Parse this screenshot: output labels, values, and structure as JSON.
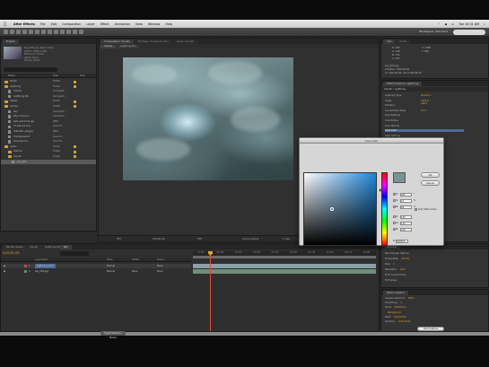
{
  "menubar": {
    "apple": "",
    "app": "After Effects",
    "items": [
      "File",
      "Edit",
      "Composition",
      "Layer",
      "Effect",
      "Animation",
      "View",
      "Window",
      "Help"
    ],
    "clock": "Tue 10:31 AM",
    "right_icons": [
      "wifi-icon",
      "volume-icon",
      "battery-icon"
    ]
  },
  "toolbar": {
    "workspace_label": "Workspace: Standard",
    "search_placeholder": "Search Help"
  },
  "project": {
    "tab": "Project",
    "meta": [
      "sky_001.jpg, used 1 time",
      "1920 x 1080 (1.00)",
      "Millions of Colors",
      "Alpha: None",
      "Frame: Direct"
    ],
    "columns": {
      "name": "Name",
      "type": "Type",
      "size": "Size"
    },
    "items": [
      {
        "name": "Solids",
        "type": "Folder",
        "kind": "folder",
        "indent": 0
      },
      {
        "name": "Lightning",
        "type": "Folder",
        "kind": "folder",
        "indent": 0
      },
      {
        "name": "Clouds",
        "type": "Composit...",
        "kind": "file",
        "indent": 1
      },
      {
        "name": "Lightning Pre",
        "type": "Composit...",
        "kind": "file",
        "indent": 1
      },
      {
        "name": "Assets",
        "type": "Folder",
        "kind": "folder",
        "indent": 0
      },
      {
        "name": "Comps",
        "type": "Folder",
        "kind": "folder",
        "indent": 0
      },
      {
        "name": "Sky",
        "type": "Composit...",
        "kind": "file",
        "indent": 1
      },
      {
        "name": "Sky 2 Comp 1",
        "type": "Composit...",
        "kind": "file",
        "indent": 1
      },
      {
        "name": "bolt_electrical.jpg",
        "type": "JPEG",
        "kind": "file",
        "indent": 1
      },
      {
        "name": "clouds_01.mov",
        "type": "QuickTi...",
        "kind": "file",
        "indent": 1
      },
      {
        "name": "dramatic_sky.jpg",
        "type": "JPEG",
        "kind": "file",
        "indent": 1
      },
      {
        "name": "FrameGrab.tif",
        "type": "QuickTi...",
        "kind": "file",
        "indent": 1
      },
      {
        "name": "Overlay.mov",
        "type": "QuickTi...",
        "kind": "file",
        "indent": 1
      },
      {
        "name": "Audio",
        "type": "Folder",
        "kind": "folder",
        "indent": 0
      },
      {
        "name": "Texture",
        "type": "Folder",
        "kind": "folder",
        "indent": 1
      },
      {
        "name": "Clouds",
        "type": "Folder",
        "kind": "folder",
        "indent": 1
      },
      {
        "name": "sky_001",
        "type": "",
        "kind": "file",
        "indent": 2,
        "selected": true
      }
    ]
  },
  "composition": {
    "tab": "Composition: Clouds",
    "tab_b": "Footage: clouds_01.mov",
    "tab_c": "Layer: Clouds",
    "sub_tab_a": "Clouds",
    "sub_tab_b": "Lightning Pre",
    "footer": {
      "zoom": "50%",
      "timecode": "0;00;01;05",
      "res": "Half",
      "view": "Active Camera",
      "views": "1 View",
      "offset": "+0.0"
    }
  },
  "info_panel": {
    "tab_a": "Info",
    "tab_b": "Audio",
    "lines": [
      "R: 106",
      "G: 128",
      "B: 130",
      "A: 255",
      "X: 1080",
      "Y: 456",
      "sky_001.jpg",
      "Duration: 0;00;10;00",
      "In: 0;00;00;00, Out: 0;00;09;29"
    ]
  },
  "effects": {
    "tab": "Effect Controls: Lightning",
    "layer": "Clouds • Lightning",
    "props": [
      {
        "name": "Lightning Type",
        "value": "Direction"
      },
      {
        "name": "Origin",
        "value": "1024.0, 168.0"
      },
      {
        "name": "Direction",
        "value": ""
      },
      {
        "name": "Conductivity State",
        "value": "10.0"
      },
      {
        "name": "Core Settings",
        "value": ""
      },
      {
        "name": "Core Radius",
        "value": ""
      },
      {
        "name": "Core Opacity",
        "value": ""
      },
      {
        "name": "Core Color",
        "value": "",
        "selected": true
      },
      {
        "name": "Glow Settings",
        "value": ""
      },
      {
        "name": "Glow Radius",
        "value": ""
      },
      {
        "name": "Glow Opacity",
        "value": ""
      },
      {
        "name": "Glow Color",
        "value": ""
      },
      {
        "name": "Alpha Obstacle",
        "value": "0.00"
      },
      {
        "name": "Turbulence",
        "value": "1.00"
      },
      {
        "name": "Forking",
        "value": "25.0%"
      },
      {
        "name": "Decay",
        "value": "0.30"
      },
      {
        "name": "Decay Main Core",
        "value": ""
      },
      {
        "name": "Composite on Original",
        "value": ""
      }
    ]
  },
  "color_picker": {
    "title": "Core Color",
    "ok": "OK",
    "cancel": "Cancel",
    "field_hue_color": "#1d86d8",
    "preview_color": "#7a9296",
    "only_web_colors": "Only Web Colors",
    "hsb": [
      {
        "label": "H:",
        "value": "205",
        "unit": "°"
      },
      {
        "label": "S:",
        "value": "12",
        "unit": "%"
      },
      {
        "label": "B:",
        "value": "58",
        "unit": "%"
      }
    ],
    "rgb": [
      {
        "label": "R:",
        "value": "130"
      },
      {
        "label": "G:",
        "value": "142"
      },
      {
        "label": "B:",
        "value": "149"
      }
    ],
    "hex_label": "#",
    "hex_value": "828E95"
  },
  "timeline": {
    "tabs": [
      "Render Queue",
      "Clouds",
      "Lightning Pre",
      "Sky"
    ],
    "active_tab": "Clouds",
    "timecode": "0;00;01;05",
    "columns": {
      "name": "Layer Name",
      "mode": "Mode",
      "trkmat": "TrkMat",
      "parent": "Parent"
    },
    "layers": [
      {
        "num": "1",
        "name": "Lightning Solid",
        "mode": "Normal",
        "trkmat": "",
        "parent": "None",
        "label": "#c04a4a",
        "bar": "#8aa0a8"
      },
      {
        "num": "2",
        "name": "sky_001.jpg",
        "mode": "Normal",
        "trkmat": "None",
        "parent": "None",
        "label": "#5f8f6f",
        "bar": "#6f8f78"
      }
    ],
    "ruler": [
      "0:15f",
      "01:00f",
      "01:15f",
      "02:00f",
      "02:15f",
      "03:00f",
      "03:15f",
      "04:00f",
      "04:15f",
      "05:00f"
    ],
    "footer_button": "Toggle Switches / Modes"
  },
  "preview_panel": {
    "tab": "Preview",
    "rows": [
      {
        "label": "Ram Preview Options",
        "value": ""
      },
      {
        "label": "Frame Rate:",
        "value": "(29.97)"
      },
      {
        "label": "Skip:",
        "value": "0"
      },
      {
        "label": "Resolution:",
        "value": "Auto"
      },
      {
        "label": "From Current Time",
        "value": ""
      },
      {
        "label": "Full Screen",
        "value": ""
      }
    ]
  },
  "motion_panel": {
    "tab": "Motion Sketch",
    "rows": [
      {
        "label": "Capture speed at:",
        "value": "100%"
      },
      {
        "label": "Smoothing:",
        "value": "1"
      },
      {
        "label": "Show:",
        "value": "Wireframe"
      },
      {
        "label": "",
        "value": "Background"
      },
      {
        "label": "Start:",
        "value": "0;00;00;00"
      },
      {
        "label": "Duration:",
        "value": "0;00;10;00"
      }
    ],
    "button": "Start Capture"
  },
  "status": {
    "button": "Toggle Switches / Modes"
  }
}
